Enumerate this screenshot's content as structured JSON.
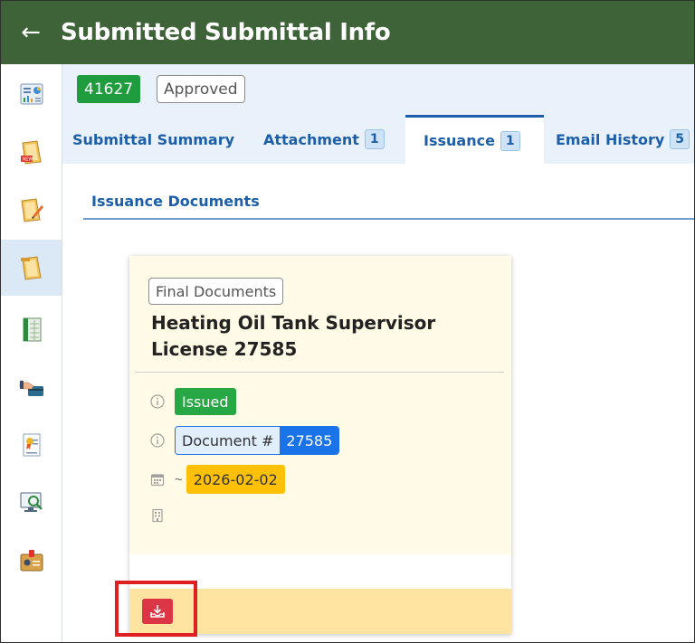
{
  "header": {
    "back_icon": "arrow-left-icon",
    "title": "Submitted Submittal Info"
  },
  "sidebar": {
    "items": [
      {
        "icon": "dashboard-chart-icon",
        "active": false
      },
      {
        "icon": "new-submittal-icon",
        "active": false
      },
      {
        "icon": "edit-submittal-icon",
        "active": false
      },
      {
        "icon": "submitted-submittal-icon",
        "active": true
      },
      {
        "icon": "spreadsheet-icon",
        "active": false
      },
      {
        "icon": "payment-card-icon",
        "active": false
      },
      {
        "icon": "certificate-icon",
        "active": false
      },
      {
        "icon": "monitor-search-icon",
        "active": false
      },
      {
        "icon": "id-badge-icon",
        "active": false
      }
    ]
  },
  "submittal": {
    "id": "41627",
    "status": "Approved"
  },
  "tabs": [
    {
      "label": "Submittal Summary",
      "count": null,
      "active": false
    },
    {
      "label": "Attachment",
      "count": "1",
      "active": false
    },
    {
      "label": "Issuance",
      "count": "1",
      "active": true
    },
    {
      "label": "Email History",
      "count": "5",
      "active": false
    }
  ],
  "section": {
    "title": "Issuance Documents"
  },
  "document_card": {
    "type": "Final Documents",
    "title": "Heating Oil Tank Supervisor License 27585",
    "status": "Issued",
    "doc_number_label": "Document #",
    "doc_number": "27585",
    "date_prefix": "~",
    "date": "2026-02-02",
    "download_icon": "download-tray-icon"
  },
  "colors": {
    "header_bg": "#3f6338",
    "accent_blue": "#1c5fa8",
    "issued_green": "#28a745",
    "date_yellow": "#ffc107",
    "download_red": "#dc3545",
    "card_bg": "#fffbe6",
    "highlight_red": "#e02020"
  }
}
